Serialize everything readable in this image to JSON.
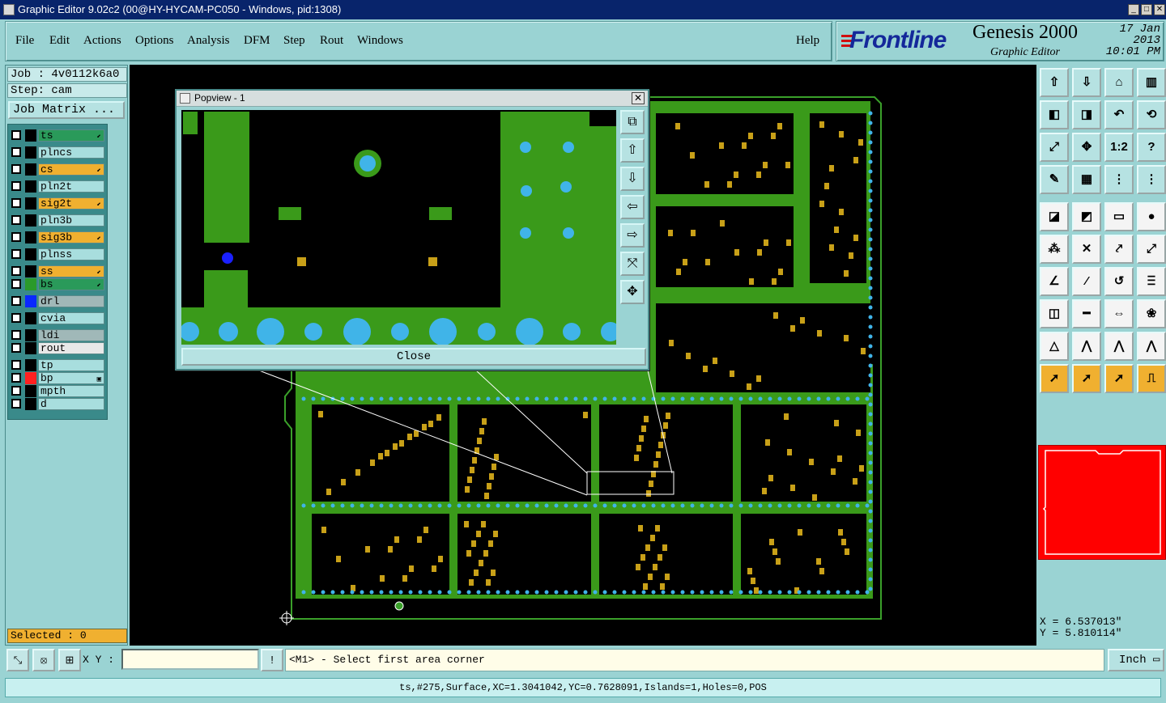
{
  "window": {
    "title": "Graphic Editor 9.02c2 (00@HY-HYCAM-PC050 - Windows, pid:1308)",
    "buttons": [
      "_",
      "□",
      "✕"
    ]
  },
  "menu": {
    "items": [
      "File",
      "Edit",
      "Actions",
      "Options",
      "Analysis",
      "DFM",
      "Step",
      "Rout",
      "Windows"
    ],
    "help": "Help"
  },
  "brand": {
    "logo": "Frontline",
    "product": "Genesis 2000",
    "subtitle": "Graphic Editor",
    "date": "17 Jan 2013",
    "time": "10:01 PM"
  },
  "job": {
    "job_label": "Job : 4v0112k6a0",
    "step_label": "Step: cam",
    "matrix_button": "Job Matrix ..."
  },
  "layers": [
    {
      "name": "ts",
      "color": "#2a9a5a",
      "swatch": "#000000",
      "mark": "⬋"
    },
    {
      "name": "plncs",
      "color": "#a8dede",
      "swatch": "#000000",
      "mark": ""
    },
    {
      "name": "cs",
      "color": "#f0b030",
      "swatch": "#000000",
      "mark": "⬋"
    },
    {
      "name": "pln2t",
      "color": "#a8dede",
      "swatch": "#000000",
      "mark": ""
    },
    {
      "name": "sig2t",
      "color": "#f0b030",
      "swatch": "#000000",
      "mark": "⬋"
    },
    {
      "name": "pln3b",
      "color": "#a8dede",
      "swatch": "#000000",
      "mark": ""
    },
    {
      "name": "sig3b",
      "color": "#f0b030",
      "swatch": "#000000",
      "mark": "⬋"
    },
    {
      "name": "plnss",
      "color": "#a8dede",
      "swatch": "#000000",
      "mark": ""
    },
    {
      "name": "ss",
      "color": "#f0b030",
      "swatch": "#000000",
      "mark": "⬋"
    },
    {
      "name": "bs",
      "color": "#2a9a5a",
      "swatch": "#2a9a2a",
      "mark": "⬋"
    },
    {
      "name": "drl",
      "color": "#a0b8b8",
      "swatch": "#0a28ff",
      "mark": ""
    },
    {
      "name": "cvia",
      "color": "#a8dede",
      "swatch": "#000000",
      "mark": ""
    },
    {
      "name": "ldi",
      "color": "#a0b8b8",
      "swatch": "#000000",
      "mark": ""
    },
    {
      "name": "rout",
      "color": "#e8e8e8",
      "swatch": "#000000",
      "mark": ""
    },
    {
      "name": "tp",
      "color": "#a8dede",
      "swatch": "#000000",
      "mark": ""
    },
    {
      "name": "bp",
      "color": "#a8dede",
      "swatch": "#ff2020",
      "mark": "▣"
    },
    {
      "name": "mpth",
      "color": "#a8dede",
      "swatch": "#000000",
      "mark": ""
    },
    {
      "name": "d",
      "color": "#a8dede",
      "swatch": "#000000",
      "mark": ""
    }
  ],
  "selected": "Selected : 0",
  "popview": {
    "title": "Popview - 1",
    "close_button": "Close",
    "close_icon": "✕"
  },
  "coords": {
    "x": "X = 6.537013\"",
    "y": "Y = 5.810114\""
  },
  "bottom": {
    "xy_label": "X Y :",
    "xy_value": "",
    "prompt": "<M1> - Select first area corner",
    "unit": "Inch"
  },
  "status": "ts,#275,Surface,XC=1.3041042,YC=0.7628091,Islands=1,Holes=0,POS"
}
